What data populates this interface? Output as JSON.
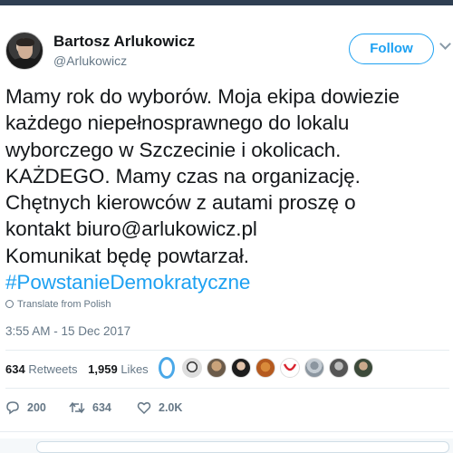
{
  "author": {
    "name": "Bartosz Arlukowicz",
    "handle": "@Arlukowicz",
    "follow_label": "Follow"
  },
  "tweet": {
    "lines": [
      "Mamy rok do wyborów. Moja ekipa dowiezie",
      "każdego niepełnosprawnego do lokalu",
      "wyborczego w Szczecinie i okolicach.",
      "KAŻDEGO. Mamy czas na organizację.",
      "Chętnych kierowców z autami proszę o",
      "kontakt biuro@arlukowicz.pl",
      "Komunikat będę powtarzał."
    ],
    "hashtag": "#PowstanieDemokratyczne",
    "translate_label": "Translate from Polish",
    "timestamp": "3:55 AM - 15 Dec 2017"
  },
  "stats": {
    "retweets_count": "634",
    "retweets_label": "Retweets",
    "likes_count": "1,959",
    "likes_label": "Likes"
  },
  "actions": {
    "reply_count": "200",
    "retweet_count": "634",
    "like_count": "2.0K"
  },
  "colors": {
    "accent": "#1da1f2",
    "secondary_text": "#657786",
    "primary_text": "#14171a"
  }
}
